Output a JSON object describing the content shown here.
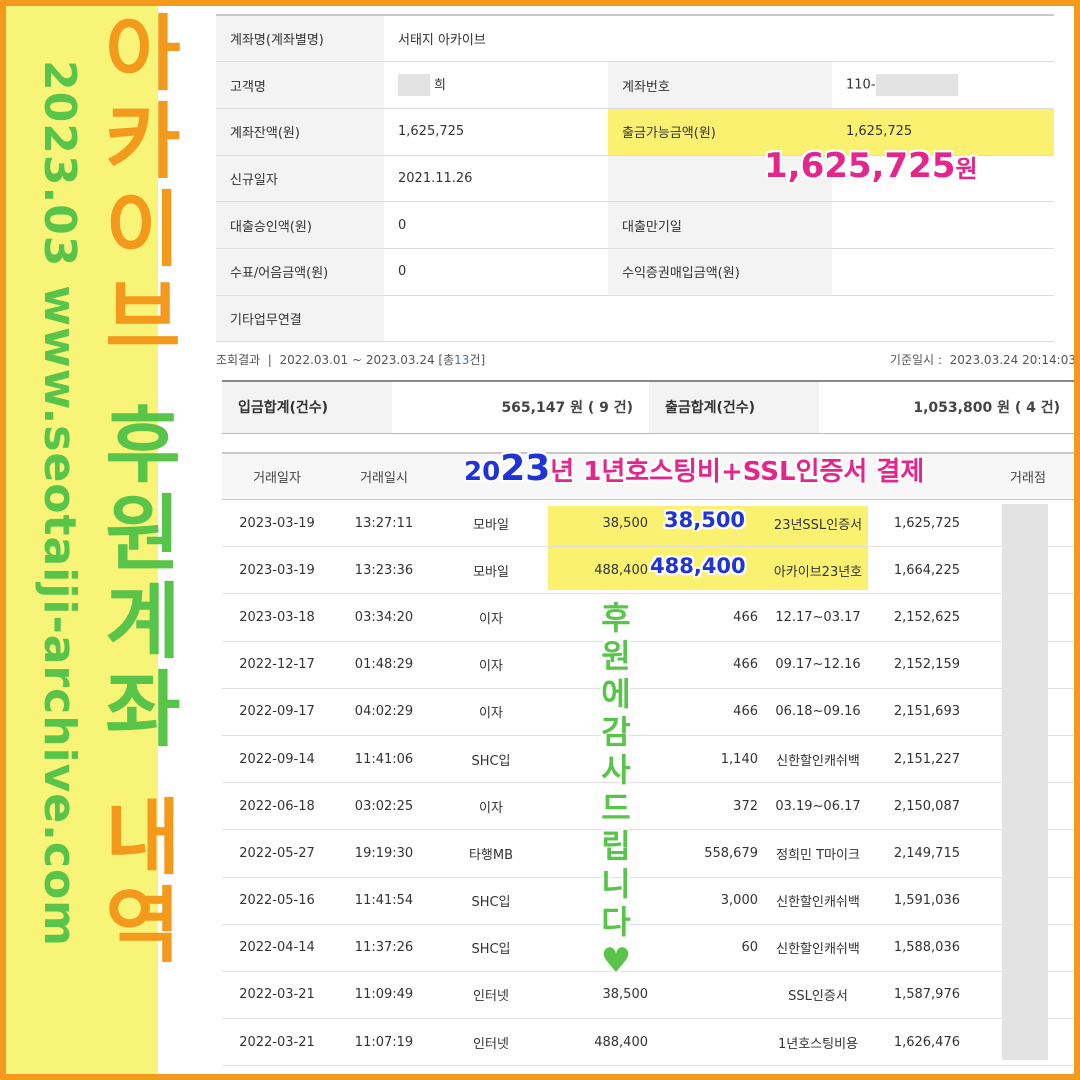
{
  "banner": {
    "date": "2023.03",
    "url": "www.seotaiji-archive.com",
    "title_orange": [
      "아",
      "카",
      "이",
      "브"
    ],
    "title_green": [
      "후",
      "원",
      "계",
      "좌"
    ],
    "title_orange2": [
      "내",
      "역"
    ]
  },
  "account": {
    "rows": [
      {
        "l1": "계좌명(계좌별명)",
        "v1": "서태지 아카이브",
        "l2": "",
        "v2": ""
      },
      {
        "l1": "고객명",
        "v1": "희",
        "l2": "계좌번호",
        "v2": "110-"
      },
      {
        "l1": "계좌잔액(원)",
        "v1": "1,625,725",
        "l2": "출금가능금액(원)",
        "v2": "1,625,725"
      },
      {
        "l1": "신규일자",
        "v1": "2021.11.26",
        "l2": "",
        "v2": ""
      },
      {
        "l1": "대출승인액(원)",
        "v1": "0",
        "l2": "대출만기일",
        "v2": ""
      },
      {
        "l1": "수표/어음금액(원)",
        "v1": "0",
        "l2": "수익증권매입금액(원)",
        "v2": ""
      },
      {
        "l1": "기타업무연결",
        "v1": "",
        "l2": "",
        "v2": ""
      }
    ]
  },
  "callout_amount": "1,625,725",
  "callout_unit": "원",
  "query": {
    "label": "조회결과",
    "range": "2022.03.01 ~ 2023.03.24",
    "total_prefix": "[총",
    "total_count": "13",
    "total_suffix": "건]",
    "base_label": "기준일시 :",
    "base_time": "2023.03.24 20:14:03"
  },
  "summary": {
    "in_label": "입금합계(건수)",
    "in_value": "565,147 원 ( 9 건)",
    "out_label": "출금합계(건수)",
    "out_value": "1,053,800 원 ( 4 건)"
  },
  "tx_header": [
    "거래일자",
    "거래일시",
    "",
    "",
    "",
    "",
    "",
    "거래점"
  ],
  "overlay": {
    "year_a": "20",
    "year_b": "23",
    "year_c": "년",
    "desc": " 1년호스팅비+SSL인증서 결제",
    "amt1": "38,500",
    "amt2": "488,400",
    "thanks": [
      "후",
      "원",
      "에",
      "감",
      "사",
      "드",
      "립",
      "니",
      "다"
    ],
    "heart": "♥"
  },
  "transactions": [
    {
      "date": "2023-03-19",
      "time": "13:27:11",
      "type": "모바일",
      "out": "38,500",
      "in": "",
      "memo": "23년SSL인증서",
      "bal": "1,625,725"
    },
    {
      "date": "2023-03-19",
      "time": "13:23:36",
      "type": "모바일",
      "out": "488,400",
      "in": "",
      "memo": "아카이브23년호",
      "bal": "1,664,225"
    },
    {
      "date": "2023-03-18",
      "time": "03:34:20",
      "type": "이자",
      "out": "",
      "in": "466",
      "memo": "12.17~03.17",
      "bal": "2,152,625"
    },
    {
      "date": "2022-12-17",
      "time": "01:48:29",
      "type": "이자",
      "out": "",
      "in": "466",
      "memo": "09.17~12.16",
      "bal": "2,152,159"
    },
    {
      "date": "2022-09-17",
      "time": "04:02:29",
      "type": "이자",
      "out": "",
      "in": "466",
      "memo": "06.18~09.16",
      "bal": "2,151,693"
    },
    {
      "date": "2022-09-14",
      "time": "11:41:06",
      "type": "SHC입",
      "out": "",
      "in": "1,140",
      "memo": "신한할인캐쉬백",
      "bal": "2,151,227"
    },
    {
      "date": "2022-06-18",
      "time": "03:02:25",
      "type": "이자",
      "out": "",
      "in": "372",
      "memo": "03.19~06.17",
      "bal": "2,150,087"
    },
    {
      "date": "2022-05-27",
      "time": "19:19:30",
      "type": "타행MB",
      "out": "",
      "in": "558,679",
      "memo": "정희민 T마이크",
      "bal": "2,149,715"
    },
    {
      "date": "2022-05-16",
      "time": "11:41:54",
      "type": "SHC입",
      "out": "",
      "in": "3,000",
      "memo": "신한할인캐쉬백",
      "bal": "1,591,036"
    },
    {
      "date": "2022-04-14",
      "time": "11:37:26",
      "type": "SHC입",
      "out": "",
      "in": "60",
      "memo": "신한할인캐쉬백",
      "bal": "1,588,036"
    },
    {
      "date": "2022-03-21",
      "time": "11:09:49",
      "type": "인터넷",
      "out": "38,500",
      "in": "",
      "memo": "SSL인증서",
      "bal": "1,587,976"
    },
    {
      "date": "2022-03-21",
      "time": "11:07:19",
      "type": "인터넷",
      "out": "488,400",
      "in": "",
      "memo": "1년호스팅비용",
      "bal": "1,626,476"
    }
  ]
}
